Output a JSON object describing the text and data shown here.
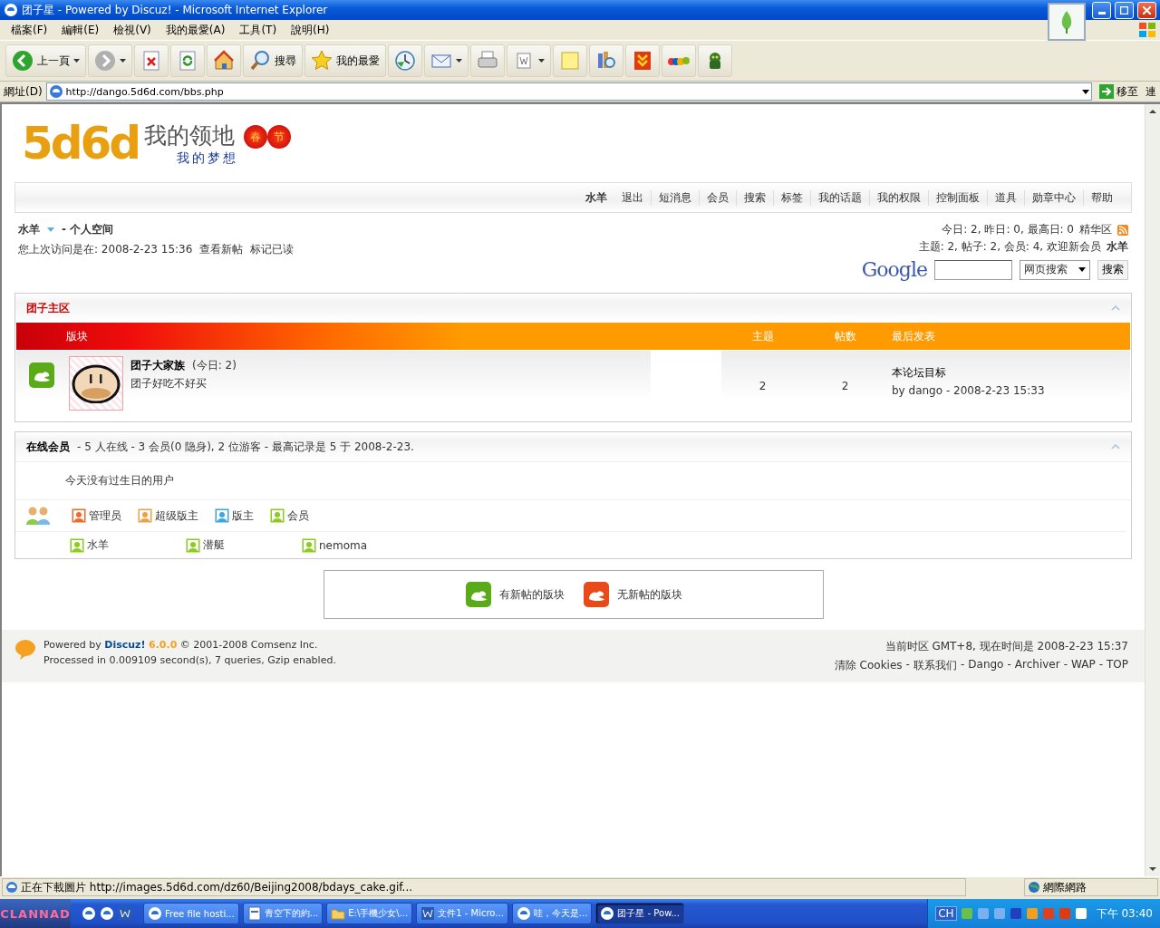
{
  "window": {
    "title": "团子星 - Powered by Discuz! - Microsoft Internet Explorer"
  },
  "menu": [
    "檔案(F)",
    "編輯(E)",
    "檢視(V)",
    "我的最愛(A)",
    "工具(T)",
    "說明(H)"
  ],
  "toolbar": [
    {
      "kind": "back",
      "label": "上一頁",
      "dropdown": true
    },
    {
      "kind": "forward",
      "dropdown": true
    },
    {
      "kind": "stop"
    },
    {
      "kind": "refresh"
    },
    {
      "kind": "home"
    },
    {
      "kind": "search",
      "label": "搜尋"
    },
    {
      "kind": "favorites",
      "label": "我的最愛"
    },
    {
      "kind": "history"
    },
    {
      "kind": "mail",
      "dropdown": true
    },
    {
      "kind": "print"
    },
    {
      "kind": "edit",
      "dropdown": true
    },
    {
      "kind": "note"
    },
    {
      "kind": "research"
    },
    {
      "kind": "download"
    },
    {
      "kind": "shop"
    },
    {
      "kind": "monster"
    }
  ],
  "address": {
    "label": "網址(D)",
    "url": "http://dango.5d6d.com/bbs.php",
    "go": "移至",
    "links": "連"
  },
  "logo": {
    "brand": "5d6d",
    "title": "我的领地",
    "subtitle": "我的梦想",
    "lanterns": [
      "春",
      "节"
    ]
  },
  "nav": [
    {
      "label": "水羊",
      "kind": "user"
    },
    {
      "label": "退出",
      "kind": "link"
    },
    {
      "label": "短消息",
      "kind": "link"
    },
    {
      "label": "会员",
      "kind": "link"
    },
    {
      "label": "搜索",
      "kind": "link"
    },
    {
      "label": "标签",
      "kind": "link"
    },
    {
      "label": "我的话题",
      "kind": "link"
    },
    {
      "label": "我的权限",
      "kind": "link"
    },
    {
      "label": "控制面板",
      "kind": "link"
    },
    {
      "label": "道具",
      "kind": "link"
    },
    {
      "label": "勋章中心",
      "kind": "link"
    },
    {
      "label": "帮助",
      "kind": "link"
    }
  ],
  "user": {
    "name": "水羊",
    "space": "- 个人空间",
    "last_visit": "您上次访问是在: 2008-2-23 15:36",
    "links": [
      "查看新帖",
      "标记已读"
    ]
  },
  "stats": {
    "line1": "今日: 2, 昨日: 0, 最高日: 0",
    "digest": "精华区",
    "line2": "主题: 2, 帖子: 2, 会员: 4, 欢迎新会员",
    "newest": "水羊"
  },
  "google": {
    "logo": "Google",
    "select": "网页搜索",
    "button": "搜索"
  },
  "forum": {
    "title": "团子主区",
    "expanded": true,
    "columns": [
      "版块",
      "主题",
      "帖数",
      "最后发表"
    ],
    "rows": [
      {
        "name": "团子大家族",
        "today": "(今日: 2)",
        "description": "团子好吃不好买",
        "topics": "2",
        "posts": "2",
        "last_title": "本论坛目标",
        "last_by": "by dango - 2008-2-23 15:33",
        "new": true
      }
    ]
  },
  "online": {
    "title": "在线会员",
    "summary": "- 5 人在线  - 3 会员(0 隐身), 2 位游客  - 最高记录是  5 于  2008-2-23.",
    "expanded": true,
    "birthday": "今天没有过生日的用户",
    "legend": [
      {
        "label": "管理员",
        "color": "#f06a2a"
      },
      {
        "label": "超级版主",
        "color": "#f0a040"
      },
      {
        "label": "版主",
        "color": "#3aa8e0"
      },
      {
        "label": "会员",
        "color": "#8ccc1a"
      }
    ],
    "members": [
      {
        "name": "水羊",
        "color": "#8ccc1a"
      },
      {
        "name": "潜艇",
        "color": "#8ccc1a"
      },
      {
        "name": "nemoma",
        "color": "#8ccc1a"
      }
    ]
  },
  "forum_legend": [
    {
      "label": "有新帖的版块",
      "new": true
    },
    {
      "label": "无新帖的版块",
      "new": false
    }
  ],
  "footer": {
    "powered": "Powered by **Discuz!**",
    "version": "6.0.0",
    "copyright": "© 2001-2008 Comsenz Inc.",
    "processed": "Processed in 0.009109 second(s), 7 queries, Gzip enabled.",
    "time": "当前时区  GMT+8, 现在时间是  2008-2-23 15:37",
    "links": [
      "清除 Cookies",
      "联系我们",
      "Dango",
      "Archiver",
      "WAP",
      "TOP"
    ],
    "separator": "-"
  },
  "status_bar": {
    "text": "正在下載圖片 http://images.5d6d.com/dz60/Beijing2008/bdays_cake.gif...",
    "zone": "網際網路"
  },
  "taskbar": {
    "start": "CLANNAD",
    "tasks": [
      {
        "label": "Free file hosti...",
        "kind": "ie",
        "selected": false
      },
      {
        "label": "青空下的約...",
        "kind": "doc",
        "selected": false
      },
      {
        "label": "E:\\手機少女\\...",
        "kind": "folder",
        "selected": false
      },
      {
        "label": "文件1 - Micro...",
        "kind": "word",
        "selected": false
      },
      {
        "label": "哇，今天是...",
        "kind": "ie",
        "selected": false
      },
      {
        "label": "团子星 - Pow...",
        "kind": "ie",
        "selected": true
      }
    ],
    "language": "CH",
    "clock": "下午 03:40"
  }
}
